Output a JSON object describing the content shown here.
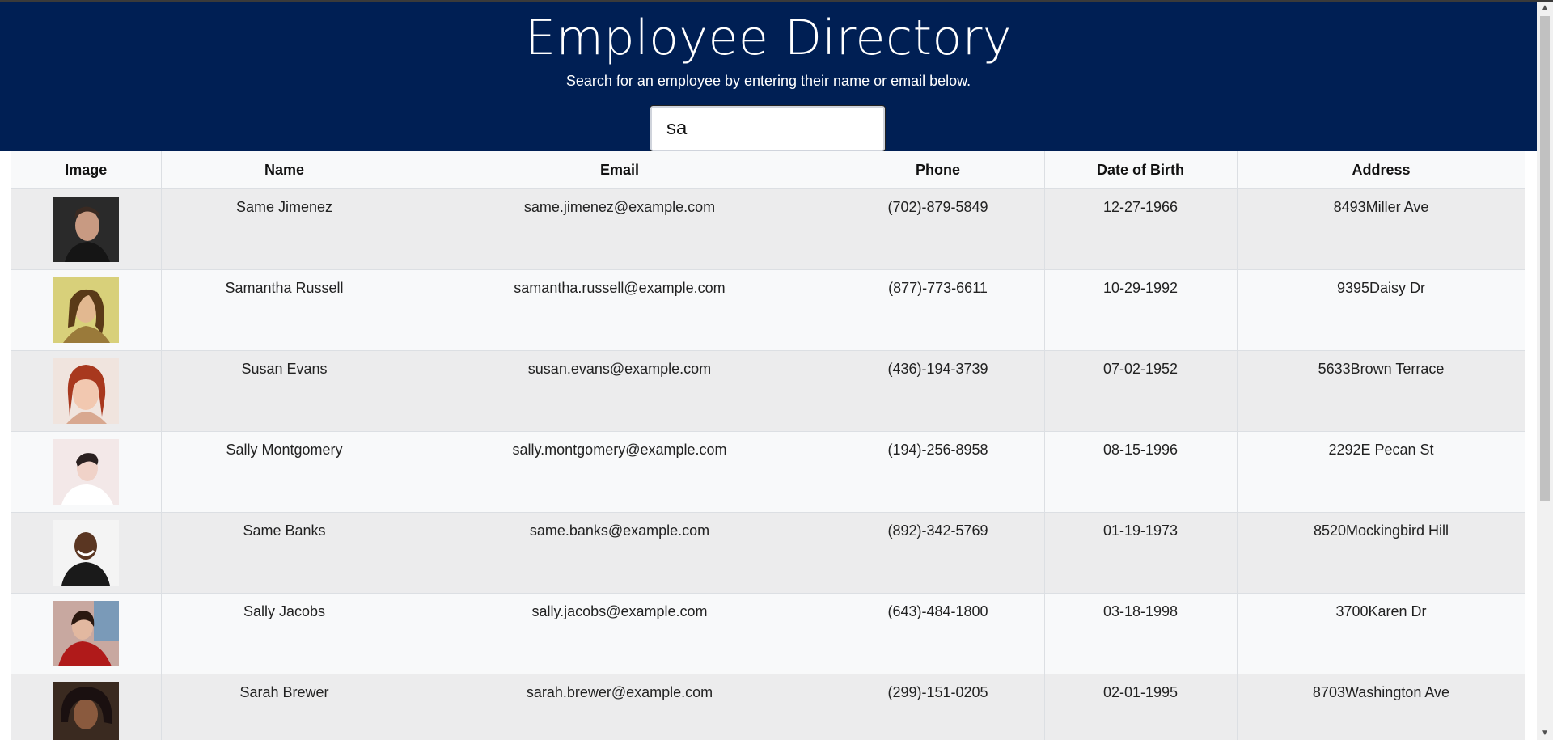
{
  "header": {
    "title": "Employee Directory",
    "subtitle": "Search for an employee by entering their name or email below."
  },
  "search": {
    "value": "sa"
  },
  "table": {
    "columns": [
      "Image",
      "Name",
      "Email",
      "Phone",
      "Date of Birth",
      "Address"
    ],
    "rows": [
      {
        "name": "Same Jimenez",
        "email": "same.jimenez@example.com",
        "phone": "(702)-879-5849",
        "dob": "12-27-1966",
        "address": "8493Miller Ave",
        "avatar": "portrait-man-dark"
      },
      {
        "name": "Samantha Russell",
        "email": "samantha.russell@example.com",
        "phone": "(877)-773-6611",
        "dob": "10-29-1992",
        "address": "9395Daisy Dr",
        "avatar": "portrait-woman-blonde"
      },
      {
        "name": "Susan Evans",
        "email": "susan.evans@example.com",
        "phone": "(436)-194-3739",
        "dob": "07-02-1952",
        "address": "5633Brown Terrace",
        "avatar": "portrait-woman-redhair"
      },
      {
        "name": "Sally Montgomery",
        "email": "sally.montgomery@example.com",
        "phone": "(194)-256-8958",
        "dob": "08-15-1996",
        "address": "2292E Pecan St",
        "avatar": "portrait-woman-light"
      },
      {
        "name": "Same Banks",
        "email": "same.banks@example.com",
        "phone": "(892)-342-5769",
        "dob": "01-19-1973",
        "address": "8520Mockingbird Hill",
        "avatar": "portrait-man-smiling"
      },
      {
        "name": "Sally Jacobs",
        "email": "sally.jacobs@example.com",
        "phone": "(643)-484-1800",
        "dob": "03-18-1998",
        "address": "3700Karen Dr",
        "avatar": "portrait-woman-red-shirt"
      },
      {
        "name": "Sarah Brewer",
        "email": "sarah.brewer@example.com",
        "phone": "(299)-151-0205",
        "dob": "02-01-1995",
        "address": "8703Washington Ave",
        "avatar": "portrait-woman-curly"
      }
    ]
  },
  "colors": {
    "header_bg": "#001f54",
    "row_odd": "#ececed",
    "row_even": "#f8f9fa"
  }
}
